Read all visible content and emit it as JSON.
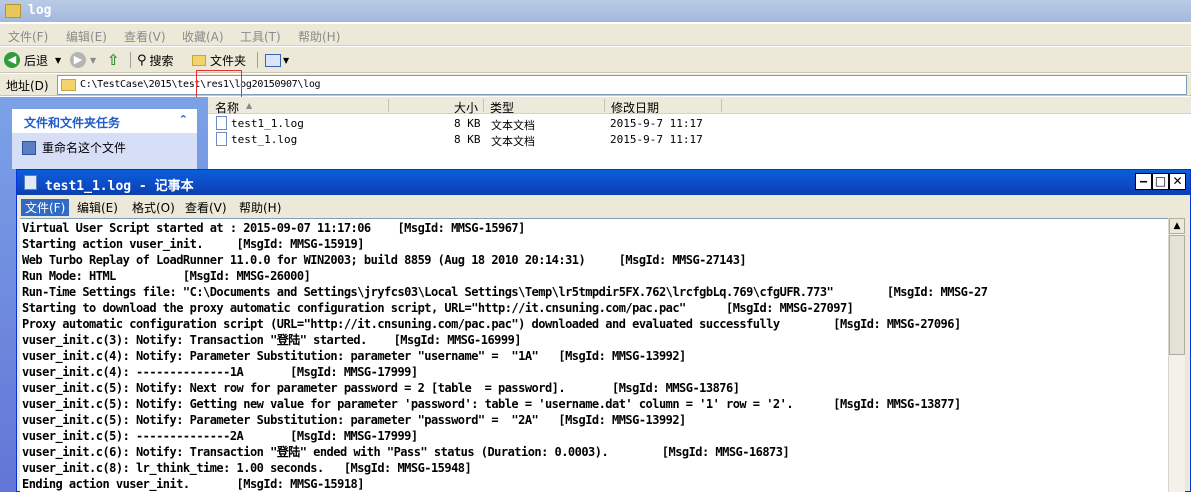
{
  "explorer": {
    "title": "log",
    "menu": [
      "文件(F)",
      "编辑(E)",
      "查看(V)",
      "收藏(A)",
      "工具(T)",
      "帮助(H)"
    ],
    "toolbar": {
      "back": "后退",
      "search": "搜索",
      "folders": "文件夹"
    },
    "address_label": "地址(D)",
    "address_value": "C:\\TestCase\\2015\\test\\res1\\log20150907\\log",
    "tasks_title": "文件和文件夹任务",
    "tasks_item": "重命名这个文件",
    "columns": {
      "name": "名称",
      "size": "大小",
      "type": "类型",
      "date": "修改日期"
    },
    "files": [
      {
        "name": "test1_1.log",
        "size": "8 KB",
        "type": "文本文档",
        "date": "2015-9-7 11:17"
      },
      {
        "name": "test_1.log",
        "size": "8 KB",
        "type": "文本文档",
        "date": "2015-9-7 11:17"
      }
    ]
  },
  "notepad": {
    "title": "test1_1.log - 记事本",
    "menu": [
      "文件(F)",
      "编辑(E)",
      "格式(O)",
      "查看(V)",
      "帮助(H)"
    ],
    "lines": [
      "Virtual User Script started at : 2015-09-07 11:17:06    [MsgId: MMSG-15967]",
      "Starting action vuser_init.     [MsgId: MMSG-15919]",
      "Web Turbo Replay of LoadRunner 11.0.0 for WIN2003; build 8859 (Aug 18 2010 20:14:31)     [MsgId: MMSG-27143]",
      "Run Mode: HTML          [MsgId: MMSG-26000]",
      "Run-Time Settings file: \"C:\\Documents and Settings\\jryfcs03\\Local Settings\\Temp\\lr5tmpdir5FX.762\\lrcfgbLq.769\\cfgUFR.773\"        [MsgId: MMSG-27",
      "Starting to download the proxy automatic configuration script, URL=\"http://it.cnsuning.com/pac.pac\"      [MsgId: MMSG-27097]",
      "Proxy automatic configuration script (URL=\"http://it.cnsuning.com/pac.pac\") downloaded and evaluated successfully        [MsgId: MMSG-27096]",
      "vuser_init.c(3): Notify: Transaction \"登陆\" started.    [MsgId: MMSG-16999]",
      "vuser_init.c(4): Notify: Parameter Substitution: parameter \"username\" =  \"1A\"   [MsgId: MMSG-13992]",
      "vuser_init.c(4): --------------1A       [MsgId: MMSG-17999]",
      "vuser_init.c(5): Notify: Next row for parameter password = 2 [table  = password].       [MsgId: MMSG-13876]",
      "vuser_init.c(5): Notify: Getting new value for parameter 'password': table = 'username.dat' column = '1' row = '2'.      [MsgId: MMSG-13877]",
      "vuser_init.c(5): Notify: Parameter Substitution: parameter \"password\" =  \"2A\"   [MsgId: MMSG-13992]",
      "vuser_init.c(5): --------------2A       [MsgId: MMSG-17999]",
      "vuser_init.c(6): Notify: Transaction \"登陆\" ended with \"Pass\" status (Duration: 0.0003).        [MsgId: MMSG-16873]",
      "vuser_init.c(8): lr_think_time: 1.00 seconds.   [MsgId: MMSG-15948]",
      "Ending action vuser_init.       [MsgId: MMSG-15918]"
    ]
  },
  "colors": {
    "xp_title_blue": "#0a5fd8",
    "explorer_bg": "#ece9d8",
    "tasks_blue": "#6375d6",
    "highlight": "#316ac5"
  }
}
